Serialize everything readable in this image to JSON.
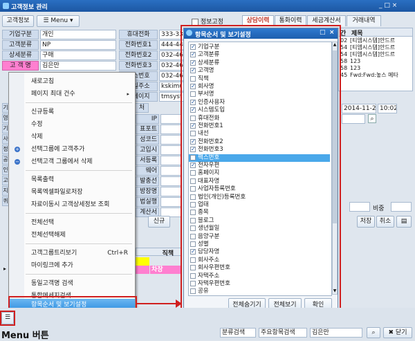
{
  "window": {
    "title": "고객정보 관리",
    "controls": "_ □ ×"
  },
  "toolbar": {
    "customer_info_button": "고객정보",
    "menu_button": "Menu"
  },
  "fields": [
    {
      "label": "기업구분",
      "value": "개인"
    },
    {
      "label": "고객분류",
      "value": "NP"
    },
    {
      "label": "상세분류",
      "value": "구매"
    },
    {
      "label": "고 객 명",
      "value": "김은만"
    }
  ],
  "phones": [
    {
      "label": "휴대전화",
      "value": "333-33"
    },
    {
      "label": "전화번호1",
      "value": "444-44"
    },
    {
      "label": "전화번호2",
      "value": "032-46"
    },
    {
      "label": "전화번호3",
      "value": "032-46"
    },
    {
      "label": "팩스번호",
      "value": "032-46"
    },
    {
      "label": "메일주소",
      "value": "kskim("
    },
    {
      "label": "홈페이지",
      "value": "tmsyst"
    }
  ],
  "top_checkbox": "정보고정",
  "tabs": [
    "상담이력",
    "통화이력",
    "세금계산서",
    "거래내역"
  ],
  "history": {
    "headers": [
      "간",
      "제목"
    ],
    "rows": [
      {
        "time": "02",
        "title": "[티엠시스템]안드르"
      },
      {
        "time": "54",
        "title": "[티엠시스템]안드르"
      },
      {
        "time": "54",
        "title": "[티엠시스템]안드르"
      },
      {
        "time": "58",
        "title": "123"
      },
      {
        "time": "58",
        "title": "123"
      },
      {
        "time": "45",
        "title": "Fwd:Fwd:놓스 메타"
      }
    ]
  },
  "date_field": "2014-11-24",
  "time_field": "10:02",
  "middle_labels": [
    "IP",
    "표포트",
    "성코드",
    "고입시",
    "서등록",
    "웨어",
    "발충선",
    "방장명",
    "법실행",
    "계산서"
  ],
  "row_labels": [
    "기",
    "영업",
    "기",
    "사",
    "정",
    "공",
    "인",
    "고객",
    "지",
    "퀴"
  ],
  "ratio_label": "비중",
  "buttons": {
    "new": "신규",
    "save": "저장",
    "cancel": "취소"
  },
  "grid": {
    "header": "직책",
    "row1": "",
    "row2": "차장"
  },
  "context_menu": {
    "items": [
      {
        "label": "새로고침"
      },
      {
        "label": "페이지 최대 건수",
        "arrow": "▸"
      },
      {
        "label": "신규등록"
      },
      {
        "label": "수정"
      },
      {
        "label": "삭제"
      },
      {
        "label": "선택그룹에 고객추가"
      },
      {
        "label": "선택고객 그룹에서 삭제"
      },
      {
        "label": "목록출력"
      },
      {
        "label": "목록엑셀파일로저장"
      },
      {
        "label": "자료이동시 고객상세정보 조회"
      },
      {
        "label": "전체선택"
      },
      {
        "label": "전체선택해제"
      },
      {
        "label": "고객그룹트리보기",
        "shortcut": "Ctrl+R"
      },
      {
        "label": "마이링크에 추가"
      },
      {
        "label": "동일고객명 검색"
      },
      {
        "label": "통합메세지검색"
      },
      {
        "label": "항목순서 및 보기설정"
      }
    ]
  },
  "dialog": {
    "title": "항목순서 및 보기설정",
    "items": [
      {
        "label": "기업구분",
        "checked": true
      },
      {
        "label": "고객분류",
        "checked": true
      },
      {
        "label": "상세분류",
        "checked": true
      },
      {
        "label": "고객명",
        "checked": true
      },
      {
        "label": "직책",
        "checked": false
      },
      {
        "label": "회사명",
        "checked": true
      },
      {
        "label": "부서명",
        "checked": false
      },
      {
        "label": "인증사용자",
        "checked": true
      },
      {
        "label": "시스템도입",
        "checked": true
      },
      {
        "label": "휴대전화",
        "checked": false
      },
      {
        "label": "전화번호1",
        "checked": true
      },
      {
        "label": "내선",
        "checked": false
      },
      {
        "label": "전화번호2",
        "checked": true
      },
      {
        "label": "전화번호3",
        "checked": true
      },
      {
        "label": "팩스번호",
        "checked": false,
        "selected": true
      },
      {
        "label": "전자우편",
        "checked": true
      },
      {
        "label": "홈페이지",
        "checked": false
      },
      {
        "label": "대표자명",
        "checked": false
      },
      {
        "label": "사업자등록번호",
        "checked": false
      },
      {
        "label": "법인(개인)등록번호",
        "checked": false
      },
      {
        "label": "업태",
        "checked": false
      },
      {
        "label": "종목",
        "checked": false
      },
      {
        "label": "블로그",
        "checked": false
      },
      {
        "label": "생년월일",
        "checked": false
      },
      {
        "label": "음양구분",
        "checked": false
      },
      {
        "label": "성별",
        "checked": false
      },
      {
        "label": "담당자명",
        "checked": true
      },
      {
        "label": "회사주소",
        "checked": false
      },
      {
        "label": "회사우편번호",
        "checked": false
      },
      {
        "label": "자택주소",
        "checked": false
      },
      {
        "label": "자택우편번호",
        "checked": false
      },
      {
        "label": "공유",
        "checked": false
      }
    ],
    "buttons": {
      "hide_all": "전체숨기기",
      "show_all": "전체보기",
      "ok": "확인"
    }
  },
  "annotation": "Menu 버튼",
  "bottom_bar": {
    "filter1": "분류검색",
    "filter2": "주요항목검색",
    "search_value": "김은만",
    "close": "닫기"
  },
  "colors": {
    "title_blue": "#1c57a3",
    "highlight": "#4aa8ea",
    "red": "#d01f1f",
    "yellow": "#ffff00",
    "pink": "#ff7fd0"
  }
}
